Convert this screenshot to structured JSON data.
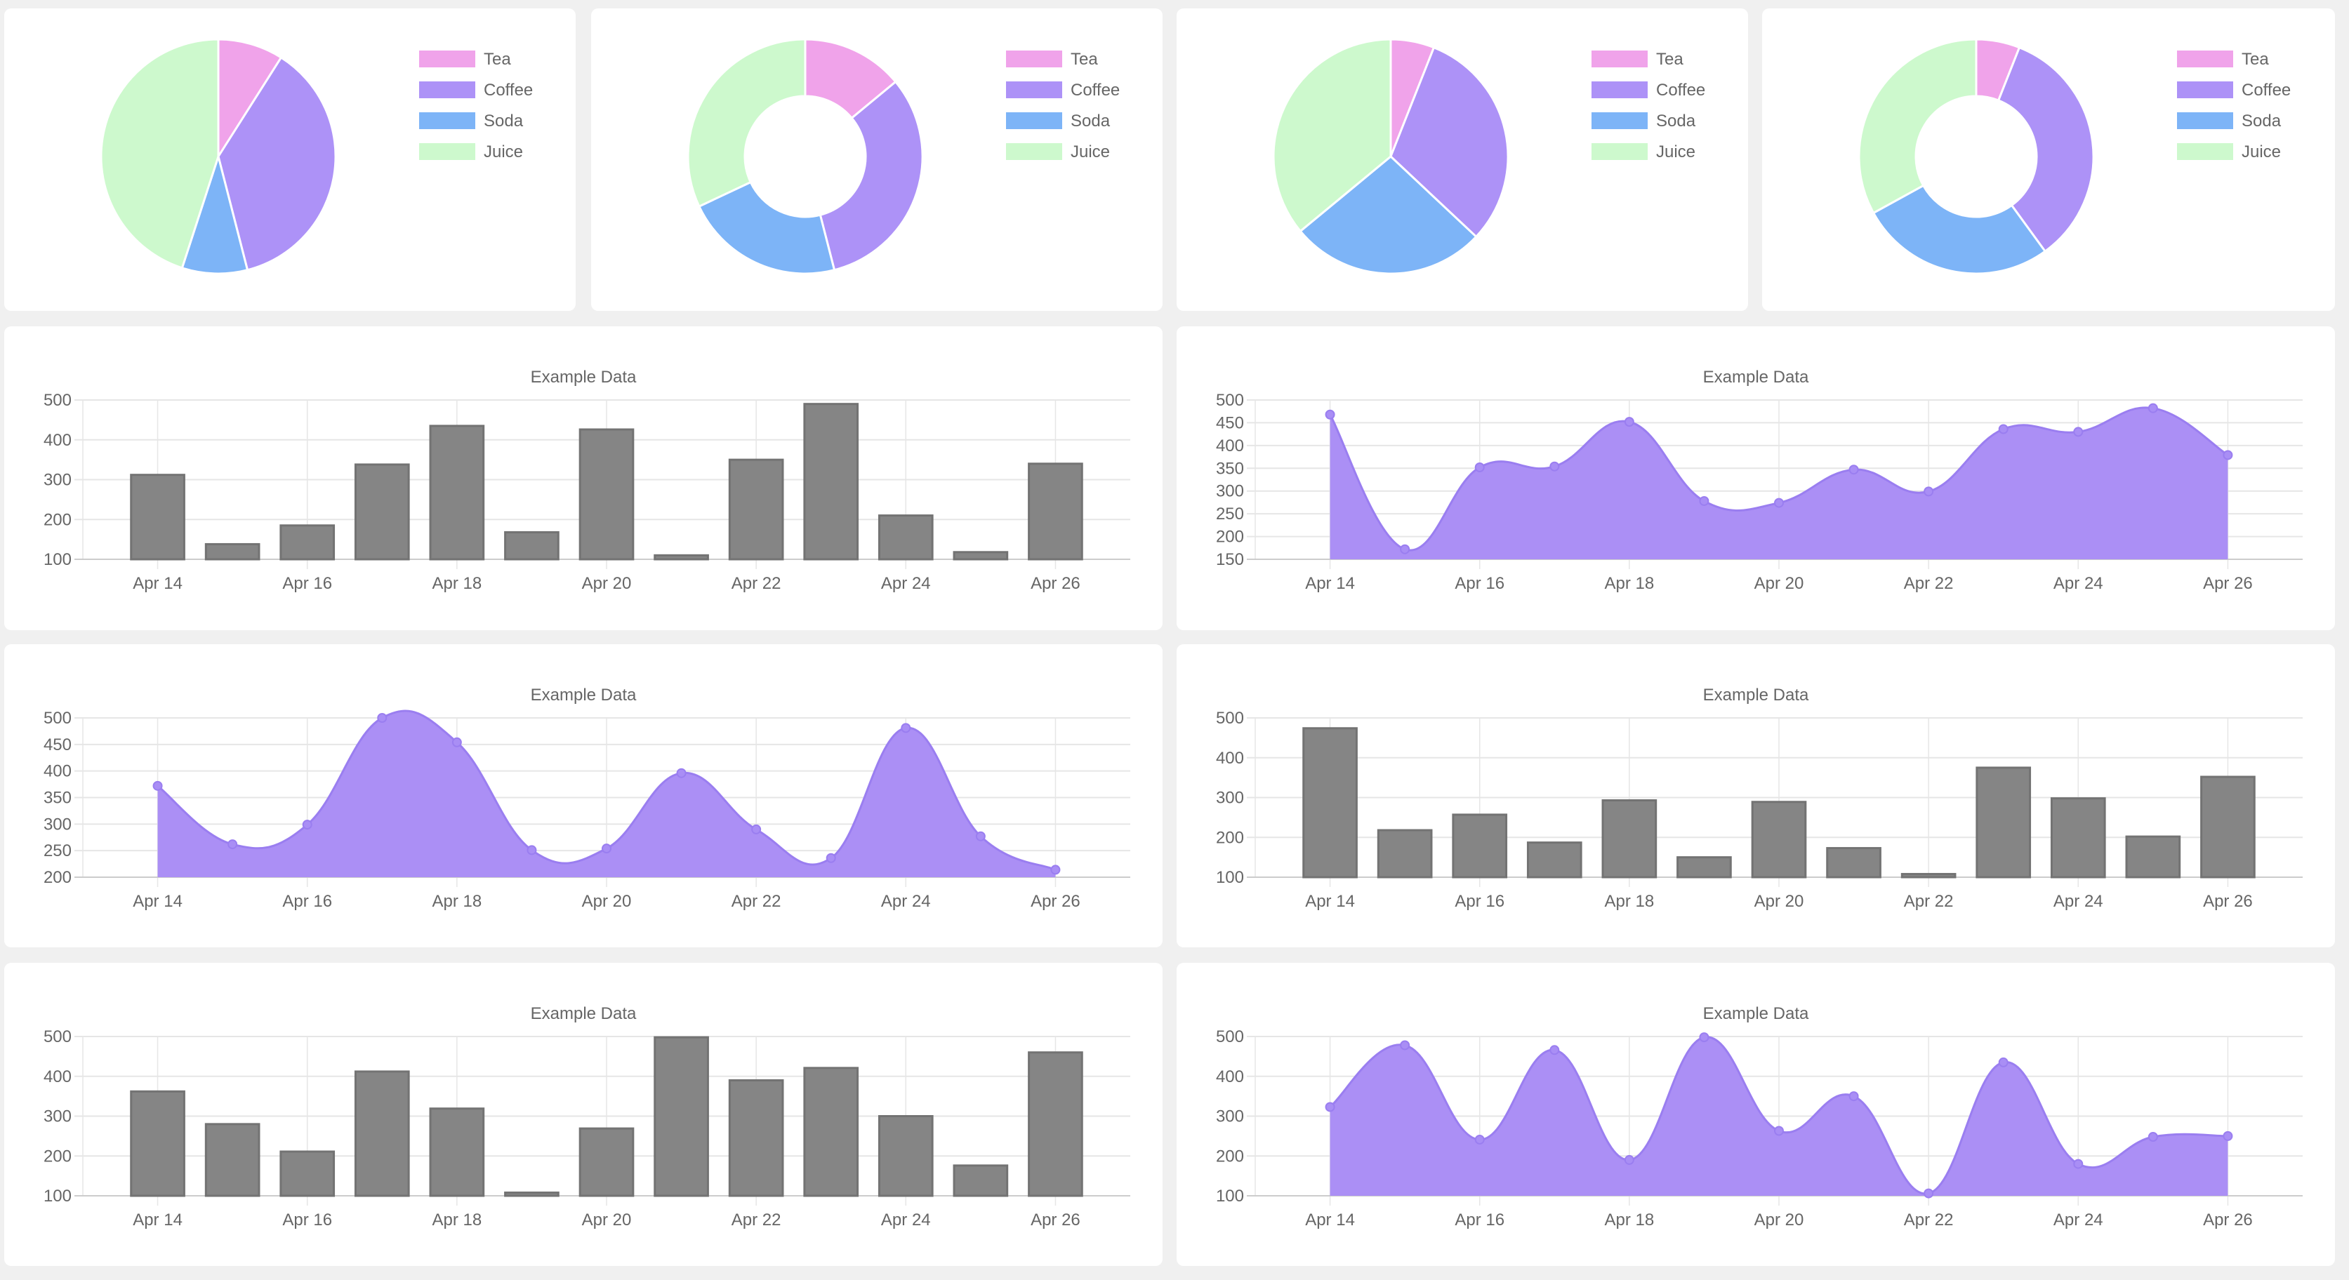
{
  "theme": {
    "background": "#f0f0f0",
    "card": "#ffffff",
    "text": "#666666",
    "grid": "#e6e6e6",
    "axis": "#cccccc",
    "bar_fill": "#858585",
    "bar_border": "#737373",
    "line_fill": "#ab8ff5",
    "point_fill": "#a98ef5",
    "point_border": "#9a7ef0"
  },
  "chart_data": [
    {
      "id": "pie-1",
      "type": "pie",
      "labels": [
        "Tea",
        "Coffee",
        "Soda",
        "Juice"
      ],
      "colors": [
        "#f0a3ea",
        "#ad92f7",
        "#7db4f7",
        "#cdf9cd"
      ],
      "values": [
        9,
        37,
        9,
        45
      ],
      "legend": "right"
    },
    {
      "id": "doughnut-1",
      "type": "pie",
      "variant": "doughnut",
      "labels": [
        "Tea",
        "Coffee",
        "Soda",
        "Juice"
      ],
      "colors": [
        "#f0a3ea",
        "#ad92f7",
        "#7db4f7",
        "#cdf9cd"
      ],
      "values": [
        14,
        32,
        22,
        32
      ],
      "legend": "right"
    },
    {
      "id": "pie-2",
      "type": "pie",
      "labels": [
        "Tea",
        "Coffee",
        "Soda",
        "Juice"
      ],
      "colors": [
        "#f0a3ea",
        "#ad92f7",
        "#7db4f7",
        "#cdf9cd"
      ],
      "values": [
        6,
        31,
        27,
        36
      ],
      "legend": "right"
    },
    {
      "id": "doughnut-2",
      "type": "pie",
      "variant": "doughnut",
      "labels": [
        "Tea",
        "Coffee",
        "Soda",
        "Juice"
      ],
      "colors": [
        "#f0a3ea",
        "#ad92f7",
        "#7db4f7",
        "#cdf9cd"
      ],
      "values": [
        6,
        34,
        27,
        33
      ],
      "legend": "right"
    },
    {
      "id": "bar-1",
      "type": "bar",
      "title": "Example Data",
      "categories": [
        "Apr 14",
        "Apr 15",
        "Apr 16",
        "Apr 17",
        "Apr 18",
        "Apr 19",
        "Apr 20",
        "Apr 21",
        "Apr 22",
        "Apr 23",
        "Apr 24",
        "Apr 25",
        "Apr 26"
      ],
      "tick_labels": [
        "Apr 14",
        "Apr 16",
        "Apr 18",
        "Apr 20",
        "Apr 22",
        "Apr 24",
        "Apr 26"
      ],
      "values": [
        312,
        138,
        185,
        338,
        435,
        168,
        426,
        110,
        350,
        490,
        210,
        118,
        340
      ],
      "ylim": [
        100,
        500
      ],
      "yticks": [
        100,
        200,
        300,
        400,
        500
      ],
      "grid": true,
      "xlabel": "",
      "ylabel": ""
    },
    {
      "id": "line-1",
      "type": "area",
      "title": "Example Data",
      "categories": [
        "Apr 14",
        "Apr 15",
        "Apr 16",
        "Apr 17",
        "Apr 18",
        "Apr 19",
        "Apr 20",
        "Apr 21",
        "Apr 22",
        "Apr 23",
        "Apr 24",
        "Apr 25",
        "Apr 26"
      ],
      "tick_labels": [
        "Apr 14",
        "Apr 16",
        "Apr 18",
        "Apr 20",
        "Apr 22",
        "Apr 24",
        "Apr 26"
      ],
      "values": [
        468,
        172,
        352,
        354,
        452,
        278,
        274,
        347,
        299,
        436,
        430,
        482,
        379
      ],
      "ylim": [
        150,
        500
      ],
      "yticks": [
        150,
        200,
        250,
        300,
        350,
        400,
        450,
        500
      ],
      "grid": true,
      "xlabel": "",
      "ylabel": ""
    },
    {
      "id": "line-2",
      "type": "area",
      "title": "Example Data",
      "categories": [
        "Apr 14",
        "Apr 15",
        "Apr 16",
        "Apr 17",
        "Apr 18",
        "Apr 19",
        "Apr 20",
        "Apr 21",
        "Apr 22",
        "Apr 23",
        "Apr 24",
        "Apr 25",
        "Apr 26"
      ],
      "tick_labels": [
        "Apr 14",
        "Apr 16",
        "Apr 18",
        "Apr 20",
        "Apr 22",
        "Apr 24",
        "Apr 26"
      ],
      "values": [
        372,
        262,
        299,
        500,
        454,
        251,
        254,
        396,
        290,
        236,
        481,
        277,
        214
      ],
      "ylim": [
        200,
        500
      ],
      "yticks": [
        200,
        250,
        300,
        350,
        400,
        450,
        500
      ],
      "grid": true,
      "xlabel": "",
      "ylabel": ""
    },
    {
      "id": "bar-2",
      "type": "bar",
      "title": "Example Data",
      "categories": [
        "Apr 14",
        "Apr 15",
        "Apr 16",
        "Apr 17",
        "Apr 18",
        "Apr 19",
        "Apr 20",
        "Apr 21",
        "Apr 22",
        "Apr 23",
        "Apr 24",
        "Apr 25",
        "Apr 26"
      ],
      "tick_labels": [
        "Apr 14",
        "Apr 16",
        "Apr 18",
        "Apr 20",
        "Apr 22",
        "Apr 24",
        "Apr 26"
      ],
      "values": [
        474,
        218,
        257,
        187,
        293,
        150,
        289,
        173,
        108,
        375,
        298,
        202,
        352
      ],
      "ylim": [
        100,
        500
      ],
      "yticks": [
        100,
        200,
        300,
        400,
        500
      ],
      "grid": true,
      "xlabel": "",
      "ylabel": ""
    },
    {
      "id": "bar-3",
      "type": "bar",
      "title": "Example Data",
      "categories": [
        "Apr 14",
        "Apr 15",
        "Apr 16",
        "Apr 17",
        "Apr 18",
        "Apr 19",
        "Apr 20",
        "Apr 21",
        "Apr 22",
        "Apr 23",
        "Apr 24",
        "Apr 25",
        "Apr 26"
      ],
      "tick_labels": [
        "Apr 14",
        "Apr 16",
        "Apr 18",
        "Apr 20",
        "Apr 22",
        "Apr 24",
        "Apr 26"
      ],
      "values": [
        362,
        280,
        211,
        412,
        319,
        108,
        269,
        498,
        390,
        421,
        300,
        176,
        460
      ],
      "ylim": [
        100,
        500
      ],
      "yticks": [
        100,
        200,
        300,
        400,
        500
      ],
      "grid": true,
      "xlabel": "",
      "ylabel": ""
    },
    {
      "id": "line-3",
      "type": "area",
      "title": "Example Data",
      "categories": [
        "Apr 14",
        "Apr 15",
        "Apr 16",
        "Apr 17",
        "Apr 18",
        "Apr 19",
        "Apr 20",
        "Apr 21",
        "Apr 22",
        "Apr 23",
        "Apr 24",
        "Apr 25",
        "Apr 26"
      ],
      "tick_labels": [
        "Apr 14",
        "Apr 16",
        "Apr 18",
        "Apr 20",
        "Apr 22",
        "Apr 24",
        "Apr 26"
      ],
      "values": [
        323,
        478,
        241,
        466,
        190,
        498,
        263,
        350,
        106,
        435,
        180,
        248,
        250
      ],
      "ylim": [
        100,
        500
      ],
      "yticks": [
        100,
        200,
        300,
        400,
        500
      ],
      "grid": true,
      "xlabel": "",
      "ylabel": ""
    }
  ]
}
